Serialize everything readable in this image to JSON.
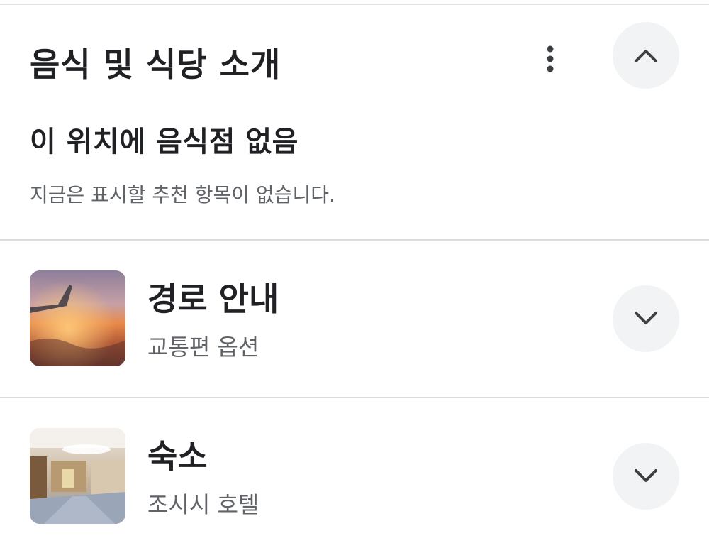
{
  "food_section": {
    "title": "음식 및 식당 소개",
    "more_icon": "more-vert-icon",
    "collapse_icon": "chevron-up-icon",
    "empty_title": "이 위치에 음식점 없음",
    "empty_description": "지금은 표시할 추천 항목이 없습니다."
  },
  "rows": [
    {
      "title": "경로 안내",
      "subtitle": "교통편 옵션",
      "image": "airplane-wing-sunset-photo",
      "expand_icon": "chevron-down-icon"
    },
    {
      "title": "숙소",
      "subtitle": "조시시 호텔",
      "image": "hotel-lobby-photo",
      "expand_icon": "chevron-down-icon"
    }
  ],
  "colors": {
    "title_text": "#202124",
    "secondary_text": "#5f6368",
    "button_bg": "#f1f3f4",
    "divider": "#dadce0"
  }
}
